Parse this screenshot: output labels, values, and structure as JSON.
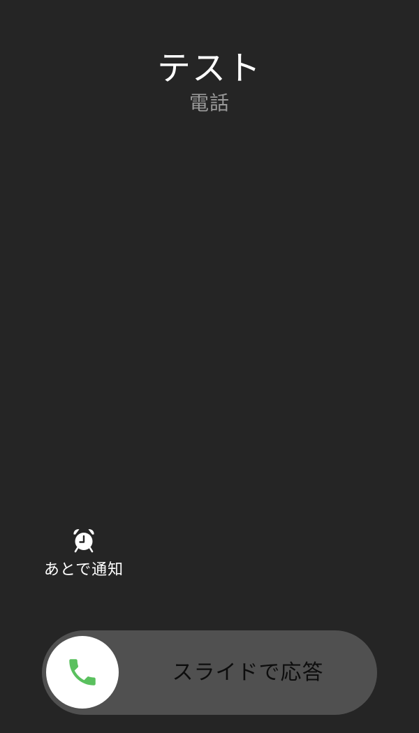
{
  "caller": {
    "name": "テスト",
    "subtitle": "電話"
  },
  "actions": {
    "remind_label": "あとで通知",
    "remind_icon": "alarm-clock-icon"
  },
  "answer_slider": {
    "label": "スライドで応答",
    "knob_icon": "phone-icon",
    "icon_color": "#5ac05e"
  },
  "colors": {
    "background": "#252525",
    "track": "#505050",
    "knob": "#ffffff",
    "subtitle": "#9a9a9a"
  }
}
